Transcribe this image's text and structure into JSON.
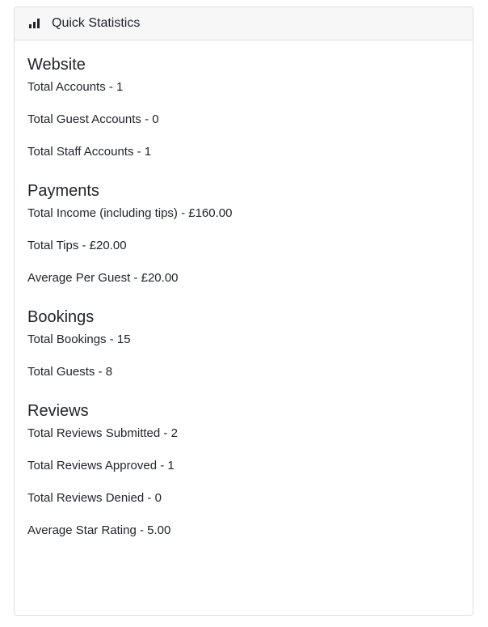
{
  "card": {
    "title": "Quick Statistics",
    "icon": "bar-chart-icon"
  },
  "sections": [
    {
      "title": "Website",
      "stats": [
        "Total Accounts - 1",
        "Total Guest Accounts - 0",
        "Total Staff Accounts - 1"
      ]
    },
    {
      "title": "Payments",
      "stats": [
        "Total Income (including tips) - £160.00",
        "Total Tips - £20.00",
        "Average Per Guest - £20.00"
      ]
    },
    {
      "title": "Bookings",
      "stats": [
        "Total Bookings - 15",
        "Total Guests - 8"
      ]
    },
    {
      "title": "Reviews",
      "stats": [
        "Total Reviews Submitted - 2",
        "Total Reviews Approved - 1",
        "Total Reviews Denied - 0",
        "Average Star Rating - 5.00"
      ]
    }
  ]
}
